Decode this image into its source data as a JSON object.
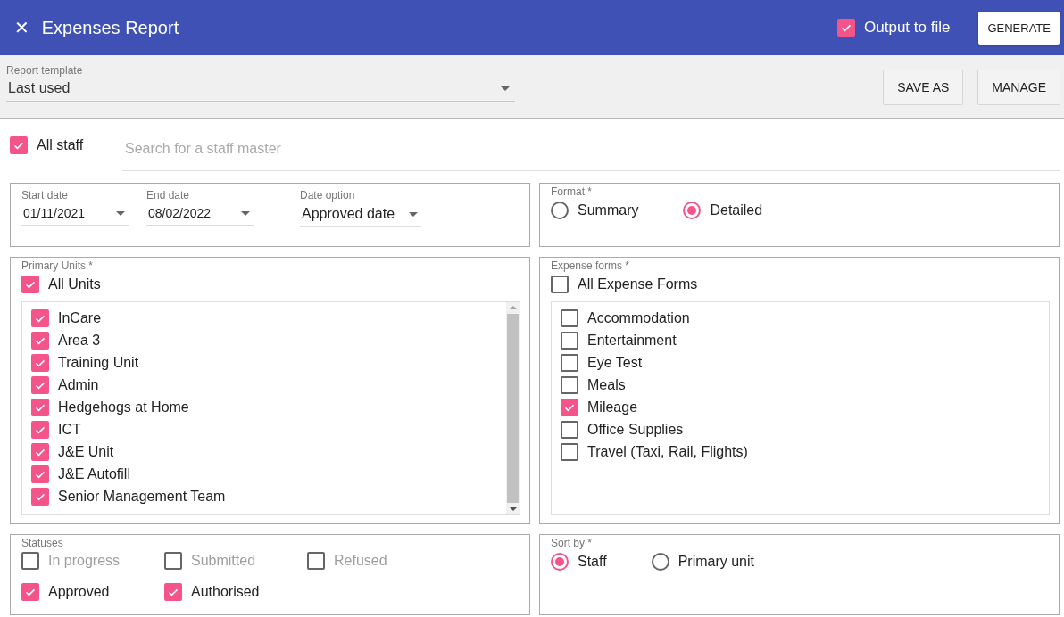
{
  "header": {
    "close_icon": "✕",
    "title": "Expenses Report",
    "output_to_file": {
      "label": "Output to file",
      "checked": true
    },
    "generate_button": "GENERATE"
  },
  "toolbar": {
    "template": {
      "label": "Report template",
      "value": "Last used"
    },
    "buttons": [
      "SAVE AS",
      "MANAGE"
    ]
  },
  "staff": {
    "all_staff": {
      "label": "All staff",
      "checked": true
    },
    "search": {
      "placeholder": "Search for a staff master"
    }
  },
  "dates": {
    "fields": [
      {
        "label": "Start date",
        "value": "01/11/2021",
        "kind": "date"
      },
      {
        "label": "End date",
        "value": "08/02/2022",
        "kind": "date"
      },
      {
        "label": "Date option",
        "value": "Approved date",
        "kind": "select"
      }
    ]
  },
  "format": {
    "label": "Format *",
    "options": [
      {
        "label": "Summary",
        "selected": false
      },
      {
        "label": "Detailed",
        "selected": true
      }
    ]
  },
  "primary_units": {
    "label": "Primary Units *",
    "all": {
      "label": "All Units",
      "checked": true
    },
    "items": [
      {
        "label": "InCare",
        "checked": true
      },
      {
        "label": "Area 3",
        "checked": true
      },
      {
        "label": "Training Unit",
        "checked": true
      },
      {
        "label": "Admin",
        "checked": true
      },
      {
        "label": "Hedgehogs at Home",
        "checked": true
      },
      {
        "label": "ICT",
        "checked": true
      },
      {
        "label": "J&E Unit",
        "checked": true
      },
      {
        "label": "J&E Autofill",
        "checked": true
      },
      {
        "label": "Senior Management Team",
        "checked": true
      }
    ]
  },
  "expense_forms": {
    "label": "Expense forms *",
    "all": {
      "label": "All Expense Forms",
      "checked": false
    },
    "items": [
      {
        "label": "Accommodation",
        "checked": false
      },
      {
        "label": "Entertainment",
        "checked": false
      },
      {
        "label": "Eye Test",
        "checked": false
      },
      {
        "label": "Meals",
        "checked": false
      },
      {
        "label": "Mileage",
        "checked": true
      },
      {
        "label": "Office Supplies",
        "checked": false
      },
      {
        "label": "Travel (Taxi, Rail, Flights)",
        "checked": false
      }
    ]
  },
  "statuses": {
    "label": "Statuses",
    "items": [
      {
        "label": "In progress",
        "checked": false
      },
      {
        "label": "Submitted",
        "checked": false
      },
      {
        "label": "Refused",
        "checked": false
      },
      {
        "label": "Approved",
        "checked": true
      },
      {
        "label": "Authorised",
        "checked": true
      }
    ]
  },
  "sort_by": {
    "label": "Sort by *",
    "options": [
      {
        "label": "Staff",
        "selected": true
      },
      {
        "label": "Primary unit",
        "selected": false
      }
    ]
  }
}
